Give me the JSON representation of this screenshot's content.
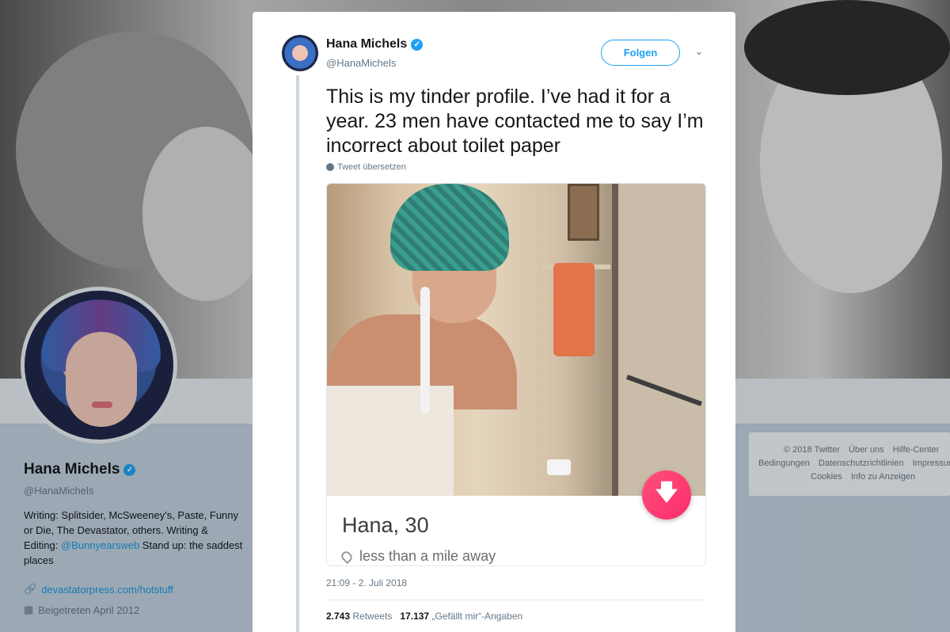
{
  "background": {
    "profile": {
      "name": "Hana Michels",
      "handle": "@HanaMichels",
      "bio_part1": "Writing: Splitsider, McSweeney's, Paste, Funny or Die, The Devastator, others. Writing & Editing: ",
      "bio_mention": "@Bunnyearsweb",
      "bio_part2": " Stand up: the saddest places",
      "website": "devastatorpress.com/hotstuff",
      "joined": "Beigetreten April 2012"
    },
    "footer": {
      "links": [
        "© 2018 Twitter",
        "Über uns",
        "Hilfe-Center",
        "Bedingungen",
        "Datenschutzrichtlinien",
        "Impressum",
        "Cookies",
        "Info zu Anzeigen"
      ]
    }
  },
  "tweet": {
    "author_name": "Hana Michels",
    "author_handle": "@HanaMichels",
    "follow_label": "Folgen",
    "text": "This is my tinder profile. I’ve had it for a year. 23 men have contacted me to say I’m incorrect about toilet paper",
    "translate_label": "Tweet übersetzen",
    "card": {
      "name_age": "Hana, 30",
      "distance": "less than a mile away"
    },
    "timestamp": "21:09 - 2. Juli 2018",
    "retweets_count": "2.743",
    "retweets_label": "Retweets",
    "likes_count": "17.137",
    "likes_label": "„Gefällt mir“-Angaben"
  },
  "icons": [
    "verified-icon",
    "caret-down-icon",
    "globe-icon",
    "location-pin-icon",
    "down-arrow-icon",
    "link-icon",
    "calendar-icon"
  ],
  "colors": {
    "accent": "#1da1f2",
    "tinder_pink": "#fc2d6b"
  }
}
